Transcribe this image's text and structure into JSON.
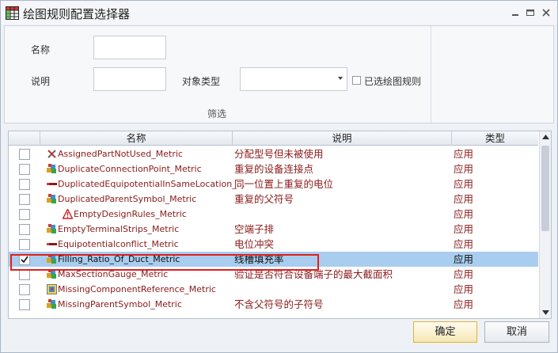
{
  "window": {
    "title": "绘图规则配置选择器"
  },
  "filter": {
    "name_label": "名称",
    "name_value": "",
    "desc_label": "说明",
    "desc_value": "",
    "object_type_label": "对象类型",
    "object_type_value": "",
    "selected_only_label": "已选绘图规则",
    "filter_label": "筛选"
  },
  "grid": {
    "columns": [
      "名称",
      "说明",
      "类型"
    ],
    "rows": [
      {
        "name": "AssignedPartNotUsed_Metric",
        "desc": "分配型号但未被使用",
        "type": "应用",
        "checked": false,
        "icon": "tools-icon"
      },
      {
        "name": "DuplicateConnectionPoint_Metric",
        "desc": "重复的设备连接点",
        "type": "应用",
        "checked": false,
        "icon": "cubes-icon"
      },
      {
        "name": "DuplicatedEquipotentialInSameLocation_...",
        "desc": "同一位置上重复的电位",
        "type": "应用",
        "checked": false,
        "icon": "wire-icon"
      },
      {
        "name": "DuplicatedParentSymbol_Metric",
        "desc": "重复的父符号",
        "type": "应用",
        "checked": false,
        "icon": "cubes-icon"
      },
      {
        "name": "EmptyDesignRules_Metric",
        "desc": "",
        "type": "应用",
        "checked": false,
        "icon": "warning-icon"
      },
      {
        "name": "EmptyTerminalStrips_Metric",
        "desc": "空端子排",
        "type": "应用",
        "checked": false,
        "icon": "cubes-icon"
      },
      {
        "name": "Equipotentialconflict_Metric",
        "desc": "电位冲突",
        "type": "应用",
        "checked": false,
        "icon": "wire-icon"
      },
      {
        "name": "Filling_Ratio_Of_Duct_Metric",
        "desc": "线槽填充率",
        "type": "应用",
        "checked": true,
        "icon": "cubes-icon",
        "selected": true
      },
      {
        "name": "MaxSectionGauge_Metric",
        "desc": "验证是否符合设备端子的最大截面积",
        "type": "应用",
        "checked": false,
        "icon": "cubes-icon"
      },
      {
        "name": "MissingComponentReference_Metric",
        "desc": "",
        "type": "应用",
        "checked": false,
        "icon": "component-icon"
      },
      {
        "name": "MissingParentSymbol_Metric",
        "desc": "不含父符号的子符号",
        "type": "应用",
        "checked": false,
        "icon": "cubes-icon"
      }
    ]
  },
  "buttons": {
    "ok": "确定",
    "cancel": "取消"
  }
}
